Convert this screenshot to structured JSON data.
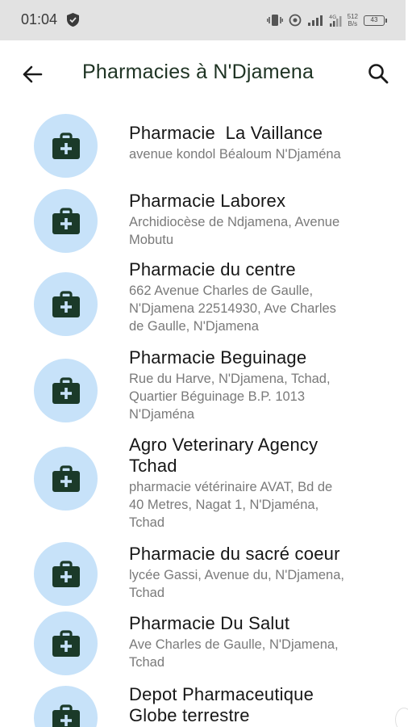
{
  "status_bar": {
    "time": "01:04",
    "net_speed_value": "512",
    "net_speed_unit": "B/s",
    "battery_level": "43"
  },
  "app_bar": {
    "title": "Pharmacies à N'Djamena"
  },
  "items": [
    {
      "title": "Pharmacie  La Vaillance",
      "address": "avenue kondol Béaloum N'Djaména"
    },
    {
      "title": "Pharmacie Laborex",
      "address": "Archidiocèse de Ndjamena, Avenue\nMobutu"
    },
    {
      "title": "Pharmacie du centre",
      "address": "662 Avenue Charles de Gaulle,\nN'Djamena 22514930, Ave Charles\nde Gaulle, N'Djamena"
    },
    {
      "title": "Pharmacie Beguinage",
      "address": "Rue du Harve, N'Djamena, Tchad,\nQuartier Béguinage B.P. 1013\nN'Djaména"
    },
    {
      "title": "Agro Veterinary Agency\nTchad",
      "address": "pharmacie vétérinaire AVAT, Bd de\n40 Metres, Nagat 1, N'Djaména,\nTchad"
    },
    {
      "title": "Pharmacie du sacré coeur",
      "address": "lycée Gassi, Avenue du, N'Djamena,\nTchad"
    },
    {
      "title": "Pharmacie Du Salut",
      "address": "Ave Charles de Gaulle, N'Djamena,\nTchad"
    },
    {
      "title": "Depot Pharmaceutique\nGlobe terrestre",
      "address": ""
    }
  ],
  "colors": {
    "avatar_bg": "#c7e2f9",
    "icon": "#1b3a29",
    "title_text": "#1e3323",
    "status_bar_bg": "#e2e2e2"
  }
}
